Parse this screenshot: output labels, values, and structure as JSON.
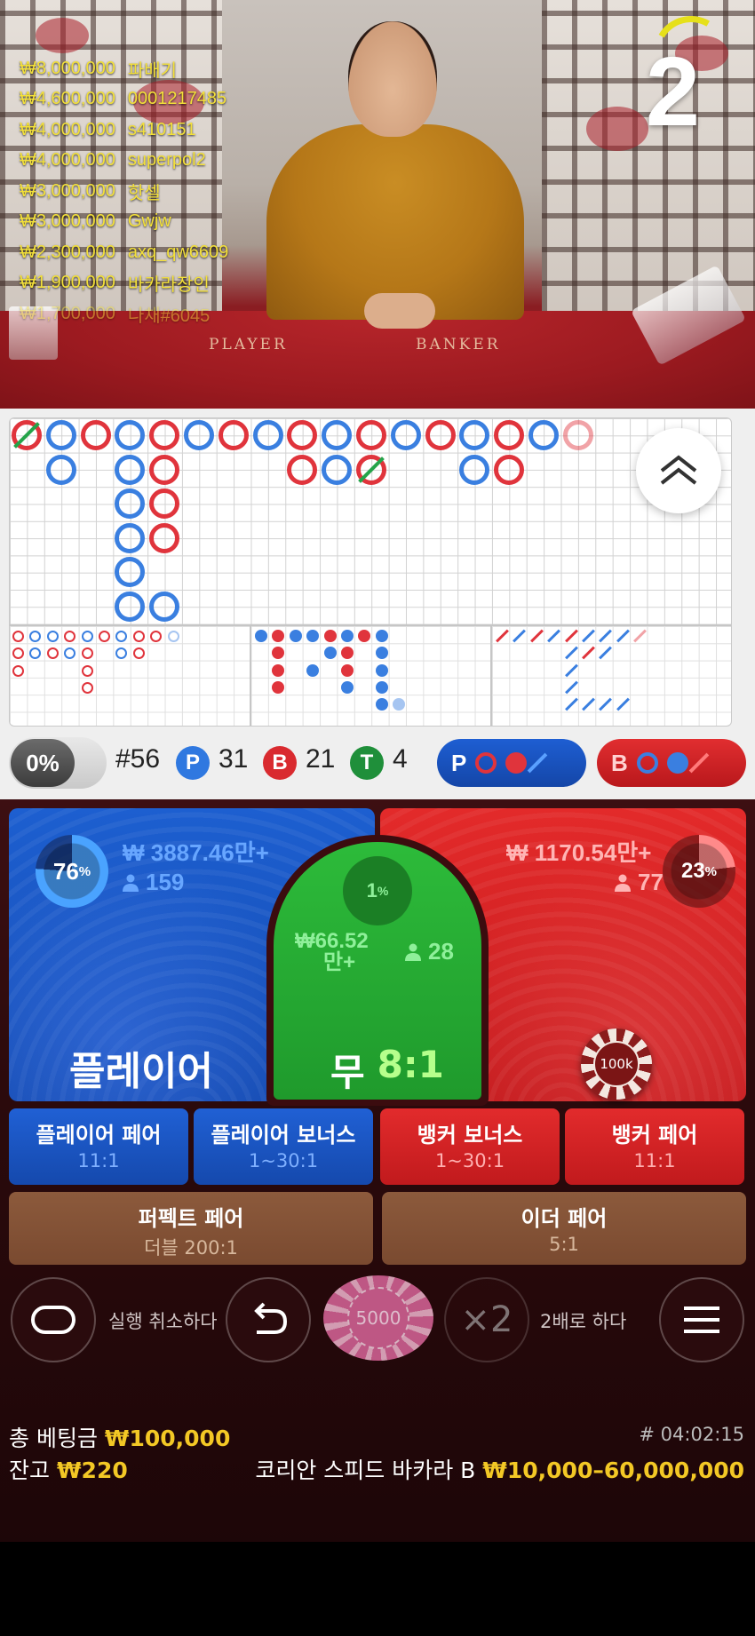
{
  "video": {
    "countdown": "2",
    "table_player": "PLAYER",
    "table_banker": "BANKER",
    "winners": [
      {
        "amount": "₩8,000,000",
        "name": "파배기"
      },
      {
        "amount": "₩4,600,000",
        "name": "0001217485"
      },
      {
        "amount": "₩4,000,000",
        "name": "s410151"
      },
      {
        "amount": "₩4,000,000",
        "name": "superpol2"
      },
      {
        "amount": "₩3,000,000",
        "name": "핫셀"
      },
      {
        "amount": "₩3,000,000",
        "name": "Gwjw"
      },
      {
        "amount": "₩2,300,000",
        "name": "axq_qw6609"
      },
      {
        "amount": "₩1,900,000",
        "name": "바카라장인"
      },
      {
        "amount": "₩1,700,000",
        "name": "나채#6045"
      }
    ]
  },
  "stats": {
    "percent": "0%",
    "round": "#56",
    "player_letter": "P",
    "player_count": "31",
    "banker_letter": "B",
    "banker_count": "21",
    "tie_letter": "T",
    "tie_count": "4",
    "player_predict": "P",
    "banker_predict": "B"
  },
  "bets": {
    "player": {
      "percent": "76",
      "amount": "₩ 3887.46만+",
      "players": "159",
      "label": "플레이어",
      "percent_fill": 0.76
    },
    "banker": {
      "percent": "23",
      "amount": "₩ 1170.54만+",
      "players": "77",
      "percent_fill": 0.23
    },
    "tie": {
      "percent": "1",
      "amount": "₩66.52",
      "amount_unit": "만+",
      "players": "28",
      "label": "무",
      "odds": "8:1"
    },
    "chip_on_banker": "100k",
    "side_bets": [
      {
        "title": "플레이어 페어",
        "odds": "11:1",
        "color": "blue"
      },
      {
        "title": "플레이어 보너스",
        "odds": "1~30:1",
        "color": "blue"
      },
      {
        "title": "뱅커 보너스",
        "odds": "1~30:1",
        "color": "red"
      },
      {
        "title": "뱅커 페어",
        "odds": "11:1",
        "color": "red"
      }
    ],
    "perfect_pair": {
      "title": "퍼펙트 페어",
      "odds": "더블 200:1"
    },
    "either_pair": {
      "title": "이더 페어",
      "odds": "5:1"
    }
  },
  "controls": {
    "undo_label": "실행 취소하다",
    "chip_value": "5000",
    "double_symbol": "×2",
    "double_label": "2배로 하다"
  },
  "footer": {
    "total_bet_label": "총 베팅금",
    "total_bet": "₩100,000",
    "balance_label": "잔고",
    "balance": "₩220",
    "round_id": "# 04:02:15",
    "table_name": "코리안 스피드 바카라 B",
    "limits": "₩10,000–60,000,000"
  },
  "colors": {
    "player_blue": "#1d5fd0",
    "banker_red": "#e32a2a",
    "tie_green": "#2dbb3a",
    "winner_gold": "#f3e03a"
  }
}
